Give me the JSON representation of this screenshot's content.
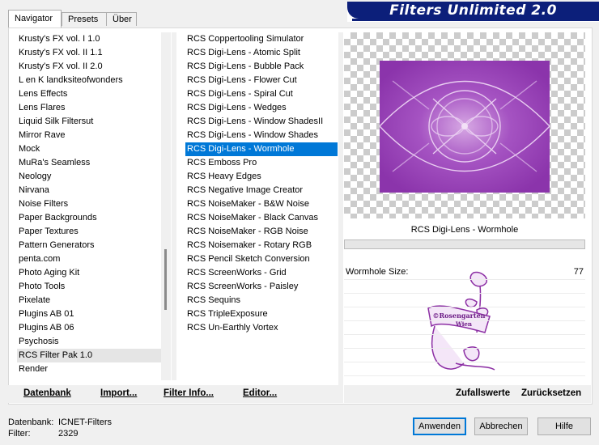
{
  "tabs": [
    "Navigator",
    "Presets",
    "Über"
  ],
  "banner_title": "Filters Unlimited 2.0",
  "categories": [
    "Krusty's FX vol. I 1.0",
    "Krusty's FX vol. II 1.1",
    "Krusty's FX vol. II 2.0",
    "L en K landksiteofwonders",
    "Lens Effects",
    "Lens Flares",
    "Liquid Silk Filtersut",
    "Mirror Rave",
    "Mock",
    "MuRa's Seamless",
    "Neology",
    "Nirvana",
    "Noise Filters",
    "Paper Backgrounds",
    "Paper Textures",
    "Pattern Generators",
    "penta.com",
    "Photo Aging Kit",
    "Photo Tools",
    "Pixelate",
    "Plugins AB 01",
    "Plugins AB 06",
    "Psychosis",
    "RCS Filter Pak 1.0",
    "Render"
  ],
  "selected_category": "RCS Filter Pak 1.0",
  "filters": [
    "RCS Coppertooling Simulator",
    "RCS Digi-Lens - Atomic Split",
    "RCS Digi-Lens - Bubble Pack",
    "RCS Digi-Lens - Flower Cut",
    "RCS Digi-Lens - Spiral Cut",
    "RCS Digi-Lens - Wedges",
    "RCS Digi-Lens - Window ShadesII",
    "RCS Digi-Lens - Window Shades",
    "RCS Digi-Lens - Wormhole",
    "RCS Emboss Pro",
    "RCS Heavy Edges",
    "RCS Negative Image Creator",
    "RCS NoiseMaker - B&W Noise",
    "RCS NoiseMaker - Black Canvas",
    "RCS NoiseMaker - RGB Noise",
    "RCS Noisemaker - Rotary RGB",
    "RCS Pencil Sketch Conversion",
    "RCS ScreenWorks - Grid",
    "RCS ScreenWorks - Paisley",
    "RCS Sequins",
    "RCS TripleExposure",
    "RCS Un-Earthly Vortex"
  ],
  "selected_filter": "RCS Digi-Lens - Wormhole",
  "preview": {
    "filter_name": "RCS Digi-Lens - Wormhole",
    "watermark_line1": "©Rosengarten",
    "watermark_line2": "Wien",
    "accent": "#a54fc0"
  },
  "params": [
    {
      "label": "Wormhole Size:",
      "value": "77"
    }
  ],
  "toolbar": {
    "datenbank": "Datenbank",
    "import": "Import...",
    "filter_info": "Filter Info...",
    "editor": "Editor...",
    "zufallswerte": "Zufallswerte",
    "zuruecksetzen": "Zurücksetzen"
  },
  "status": {
    "db_label": "Datenbank:",
    "db_value": "ICNET-Filters",
    "filter_label": "Filter:",
    "filter_value": "2329"
  },
  "buttons": {
    "apply": "Anwenden",
    "cancel": "Abbrechen",
    "help": "Hilfe"
  },
  "colors": {
    "banner": "#0c1f7a",
    "selection": "#0078d7"
  }
}
